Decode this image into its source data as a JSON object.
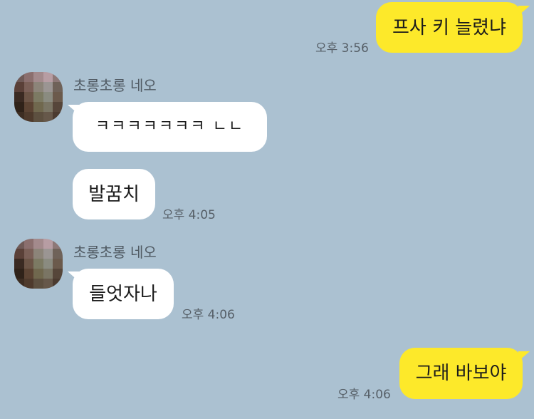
{
  "messages": {
    "m1": {
      "text": "프사 키 늘렸냐",
      "time": "오후 3:56"
    },
    "m2": {
      "sender": "초롱초롱 네오",
      "text": "ㅋㅋㅋㅋㅋㅋㅋ ㄴㄴ"
    },
    "m3": {
      "text": "발꿈치",
      "time": "오후 4:05"
    },
    "m4": {
      "sender": "초롱초롱 네오",
      "text": "들엇자나",
      "time": "오후 4:06"
    },
    "m5": {
      "text": "그래 바보야",
      "time": "오후 4:06"
    }
  },
  "colors": {
    "background": "#abc1d1",
    "my_bubble": "#fde92a",
    "other_bubble": "#ffffff"
  },
  "icons": {
    "avatar": "pixelated-profile-photo"
  }
}
